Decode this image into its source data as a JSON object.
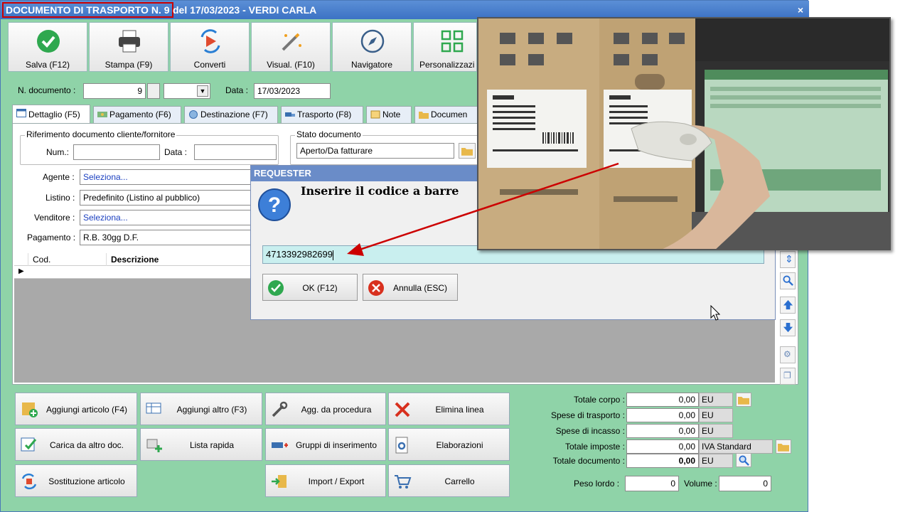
{
  "window": {
    "title_highlight": "DOCUMENTO DI TRASPORTO N. 9",
    "title_rest": "del 17/03/2023 - VERDI CARLA",
    "close_glyph": "×"
  },
  "toolbar": [
    {
      "label": "Salva (F12)",
      "icon": "check-circle-icon"
    },
    {
      "label": "Stampa (F9)",
      "icon": "printer-icon"
    },
    {
      "label": "Converti",
      "icon": "convert-icon"
    },
    {
      "label": "Visual. (F10)",
      "icon": "magic-wand-icon"
    },
    {
      "label": "Navigatore",
      "icon": "compass-icon"
    },
    {
      "label": "Personalizzazi",
      "icon": "grid-icon"
    }
  ],
  "header": {
    "ndoc_label": "N. documento :",
    "ndoc_value": "9",
    "data_label": "Data :",
    "data_value": "17/03/2023"
  },
  "tabs": [
    {
      "label": "Dettaglio (F5)",
      "active": true
    },
    {
      "label": "Pagamento (F6)"
    },
    {
      "label": "Destinazione (F7)"
    },
    {
      "label": "Trasporto (F8)"
    },
    {
      "label": "Note"
    },
    {
      "label": "Documen"
    }
  ],
  "riferimento": {
    "title": "Riferimento documento cliente/fornitore",
    "num_label": "Num.:",
    "data_label": "Data :"
  },
  "stato": {
    "title": "Stato documento",
    "value": "Aperto/Da fatturare"
  },
  "fields": {
    "agente_label": "Agente :",
    "agente_value": "Seleziona...",
    "listino_label": "Listino :",
    "listino_value": "Predefinito (Listino al pubblico)",
    "venditore_label": "Venditore :",
    "venditore_value": "Seleziona...",
    "pagamento_label": "Pagamento :",
    "pagamento_value": "R.B. 30gg D.F."
  },
  "grid": {
    "col_cod": "Cod.",
    "col_desc": "Descrizione"
  },
  "actions": [
    {
      "label": "Aggiungi articolo (F4)"
    },
    {
      "label": "Aggiungi altro (F3)"
    },
    {
      "label": "Agg. da procedura"
    },
    {
      "label": "Elimina linea"
    },
    {
      "label": "Carica da altro doc."
    },
    {
      "label": "Lista rapida"
    },
    {
      "label": "Gruppi di inserimento"
    },
    {
      "label": "Elaborazioni"
    },
    {
      "label": "Sostituzione articolo"
    },
    {
      "label": "Import / Export"
    },
    {
      "label": "Carrello"
    }
  ],
  "totals": {
    "corpo_label": "Totale corpo :",
    "corpo_value": "0,00",
    "corpo_unit": "EU",
    "trasporto_label": "Spese di trasporto :",
    "trasporto_value": "0,00",
    "trasporto_unit": "EU",
    "incasso_label": "Spese di incasso :",
    "incasso_value": "0,00",
    "incasso_unit": "EU",
    "imposte_label": "Totale imposte :",
    "imposte_value": "0,00",
    "imposte_unit": "IVA Standard",
    "documento_label": "Totale documento :",
    "documento_value": "0,00",
    "documento_unit": "EU",
    "peso_label": "Peso lordo :",
    "peso_value": "0",
    "volume_label": "Volume :",
    "volume_value": "0"
  },
  "dialog": {
    "title": "REQUESTER",
    "message": "Inserire il codice a barre",
    "barcode_value": "4713392982699",
    "ok_label": "OK (F12)",
    "cancel_label": "Annulla (ESC)"
  },
  "colors": {
    "window_bg": "#8fd3a8",
    "titlebar": "#3c72c4",
    "highlight_border": "#cc0000",
    "dialog_input": "#c9efef",
    "arrow": "#cc0000"
  }
}
